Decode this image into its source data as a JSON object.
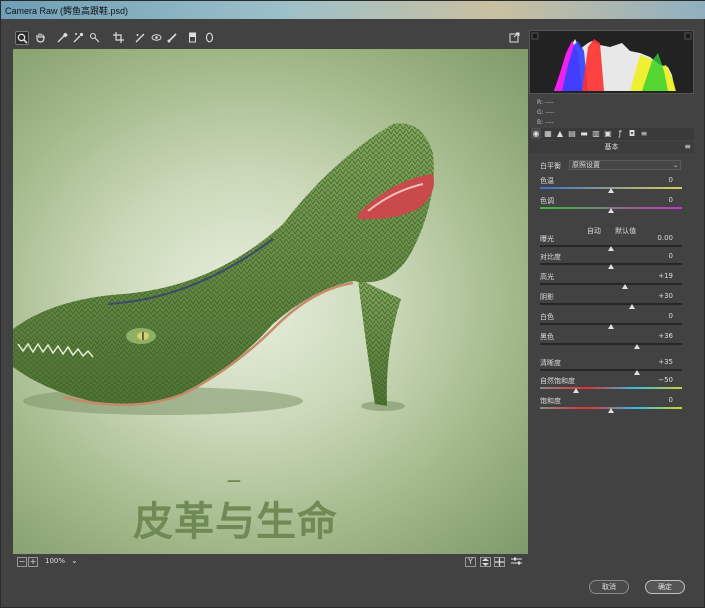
{
  "window": {
    "title": "Camera Raw (鳄鱼高跟鞋.psd)"
  },
  "canvas": {
    "headline": "皮革与生命",
    "dash": "—"
  },
  "bottom": {
    "zoom_minus": "−",
    "zoom_plus": "+",
    "zoom": "100%",
    "zoom_arrow": "⌄",
    "y_button": "Y"
  },
  "readout": {
    "r": "R:  ----",
    "g": "G:  ----",
    "b": "B:  ----"
  },
  "panel": {
    "section_title": "基本",
    "menu_icon": "≡",
    "wb_label": "白平衡",
    "wb_value": "原照设置",
    "auto": "自动",
    "default": "默认值",
    "sliders": [
      {
        "label": "色温",
        "value": "0",
        "pos": 0.5
      },
      {
        "label": "色调",
        "value": "0",
        "pos": 0.5
      },
      {
        "label": "曝光",
        "value": "0.00",
        "pos": 0.5
      },
      {
        "label": "对比度",
        "value": "0",
        "pos": 0.5
      },
      {
        "label": "高光",
        "value": "+19",
        "pos": 0.6
      },
      {
        "label": "阴影",
        "value": "+30",
        "pos": 0.65
      },
      {
        "label": "白色",
        "value": "0",
        "pos": 0.5
      },
      {
        "label": "黑色",
        "value": "+36",
        "pos": 0.68
      },
      {
        "label": "清晰度",
        "value": "+35",
        "pos": 0.68
      },
      {
        "label": "自然饱和度",
        "value": "−50",
        "pos": 0.25
      },
      {
        "label": "饱和度",
        "value": "0",
        "pos": 0.5
      }
    ]
  },
  "footer": {
    "cancel": "取消",
    "ok": "确定"
  },
  "colors": {
    "canvas_bg": "#b6c89f",
    "headline": "#6f8a54"
  },
  "icons": [
    "zoom-tool-icon",
    "hand-tool-icon",
    "white-balance-icon",
    "color-sampler-icon",
    "targeted-adjust-icon",
    "crop-icon",
    "straighten-icon",
    "red-eye-icon",
    "brush-icon",
    "graduated-filter-icon",
    "radial-filter-icon",
    "open-preferences-icon"
  ]
}
